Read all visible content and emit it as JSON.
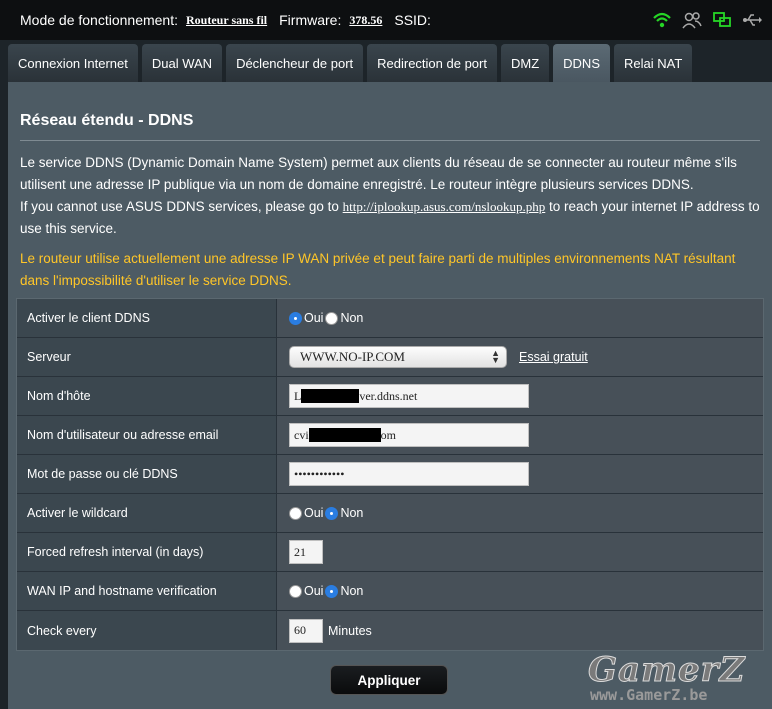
{
  "topbar": {
    "mode_label": "Mode de fonctionnement:",
    "mode_value": "Routeur sans fil",
    "firmware_label": "Firmware:",
    "firmware_value": "378.56",
    "ssid_label": "SSID:"
  },
  "tabs": [
    {
      "label": "Connexion Internet"
    },
    {
      "label": "Dual WAN"
    },
    {
      "label": "Déclencheur de port"
    },
    {
      "label": "Redirection de port"
    },
    {
      "label": "DMZ"
    },
    {
      "label": "DDNS"
    },
    {
      "label": "Relai NAT"
    }
  ],
  "page": {
    "title": "Réseau étendu - DDNS",
    "desc1": "Le service DDNS (Dynamic Domain Name System) permet aux clients du réseau de se connecter au routeur même s'ils utilisent une adresse IP publique via un nom de domaine enregistré. Le routeur intègre plusieurs services DDNS.",
    "desc2_pre": "If you cannot use ASUS DDNS services, please go to ",
    "desc2_link": "http://iplookup.asus.com/nslookup.php",
    "desc2_post": " to reach your internet IP address to use this service.",
    "warning": "Le routeur utilise actuellement une adresse IP WAN privée et peut faire parti de multiples environnements NAT résultant dans l'impossibilité d'utiliser le service DDNS."
  },
  "form": {
    "enable_label": "Activer le client DDNS",
    "server_label": "Serveur",
    "server_value": "WWW.NO-IP.COM",
    "free_trial": "Essai gratuit",
    "hostname_label": "Nom d'hôte",
    "hostname_value_pre": "L",
    "hostname_value_post": "ver.ddns.net",
    "username_label": "Nom d'utilisateur ou adresse email",
    "username_value_pre": "cvi",
    "username_value_post": "om",
    "password_label": "Mot de passe ou clé DDNS",
    "password_value": "••••••••••••",
    "wildcard_label": "Activer le wildcard",
    "refresh_label": "Forced refresh interval (in days)",
    "refresh_value": "21",
    "verify_label": "WAN IP and hostname verification",
    "check_label": "Check every",
    "check_value": "60",
    "check_unit": "Minutes",
    "yes": "Oui",
    "no": "Non"
  },
  "apply_label": "Appliquer",
  "watermark": {
    "logo": "GamerZ",
    "url": "www.GamerZ.be"
  },
  "colors": {
    "warning": "#ffc628",
    "radio_on": "#2a7de1",
    "panel": "#4d5b64"
  }
}
